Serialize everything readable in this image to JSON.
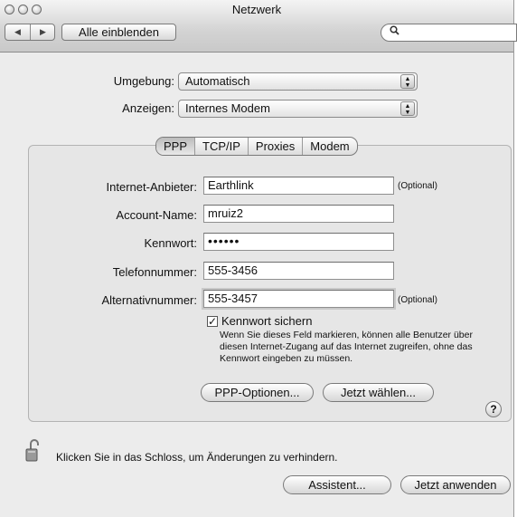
{
  "window": {
    "title": "Netzwerk"
  },
  "toolbar": {
    "back_symbol": "◀",
    "forward_symbol": "▶",
    "show_all_label": "Alle einblenden",
    "search_placeholder": ""
  },
  "location": {
    "label": "Umgebung:",
    "value": "Automatisch"
  },
  "show": {
    "label": "Anzeigen:",
    "value": "Internes Modem"
  },
  "tabs": [
    {
      "label": "PPP",
      "selected": true
    },
    {
      "label": "TCP/IP",
      "selected": false
    },
    {
      "label": "Proxies",
      "selected": false
    },
    {
      "label": "Modem",
      "selected": false
    }
  ],
  "form": {
    "provider": {
      "label": "Internet-Anbieter:",
      "value": "Earthlink",
      "note": "(Optional)"
    },
    "account": {
      "label": "Account-Name:",
      "value": "mruiz2"
    },
    "password": {
      "label": "Kennwort:",
      "value": "••••••"
    },
    "phone": {
      "label": "Telefonnummer:",
      "value": "555-3456"
    },
    "alt_phone": {
      "label": "Alternativnummer:",
      "value": "555-3457",
      "note": "(Optional)"
    },
    "save_password": {
      "checked": true,
      "label": "Kennwort sichern",
      "help": "Wenn Sie dieses Feld markieren, können alle Benutzer über diesen Internet-Zugang auf das Internet zugreifen, ohne das Kennwort eingeben zu müssen."
    },
    "ppp_options_label": "PPP-Optionen...",
    "dial_now_label": "Jetzt wählen...",
    "help_label": "?"
  },
  "footer": {
    "lock_text": "Klicken Sie in das Schloss, um Änderungen zu verhindern.",
    "assistant_label": "Assistent...",
    "apply_label": "Jetzt anwenden"
  },
  "colors": {
    "window_bg": "#ececec",
    "group_bg": "#e6e6e6",
    "border": "#7a7a7a"
  }
}
